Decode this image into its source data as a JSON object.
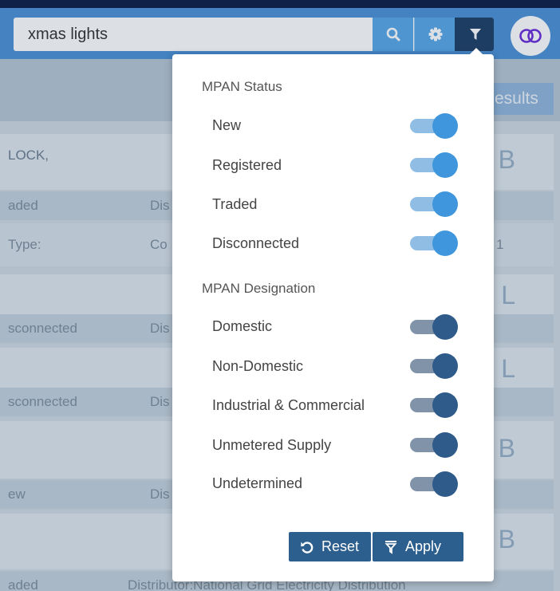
{
  "search": {
    "value": "xmas lights"
  },
  "results_label": "esults",
  "background_cards": [
    {
      "head": "LOCK,",
      "letter": "B",
      "row1_a": "aded",
      "row1_b": "Dis",
      "row2_a": "Type:",
      "row2_b": "Co",
      "row2_c": "1"
    },
    {
      "letter": "L",
      "row1_a": "sconnected",
      "row1_b": "Dis"
    },
    {
      "letter": "L",
      "row1_a": "sconnected",
      "row1_b": "Dis"
    },
    {
      "letter": "B",
      "row1_a": "ew",
      "row1_b": "Dis"
    },
    {
      "letter": "B",
      "row1_a": "aded",
      "row1_b": "Distributor:National Grid Electricity Distribution"
    }
  ],
  "filter_panel": {
    "status_title": "MPAN Status",
    "status_options": [
      {
        "label": "New",
        "enabled": true
      },
      {
        "label": "Registered",
        "enabled": true
      },
      {
        "label": "Traded",
        "enabled": true
      },
      {
        "label": "Disconnected",
        "enabled": true
      }
    ],
    "designation_title": "MPAN Designation",
    "designation_options": [
      {
        "label": "Domestic",
        "enabled": true
      },
      {
        "label": "Non-Domestic",
        "enabled": true
      },
      {
        "label": "Industrial & Commercial",
        "enabled": true
      },
      {
        "label": "Unmetered Supply",
        "enabled": true
      },
      {
        "label": "Undetermined",
        "enabled": true
      }
    ],
    "reset_label": "Reset",
    "apply_label": "Apply"
  },
  "colors": {
    "accent": "#3f96dc",
    "dark_accent": "#2c5f8e"
  }
}
